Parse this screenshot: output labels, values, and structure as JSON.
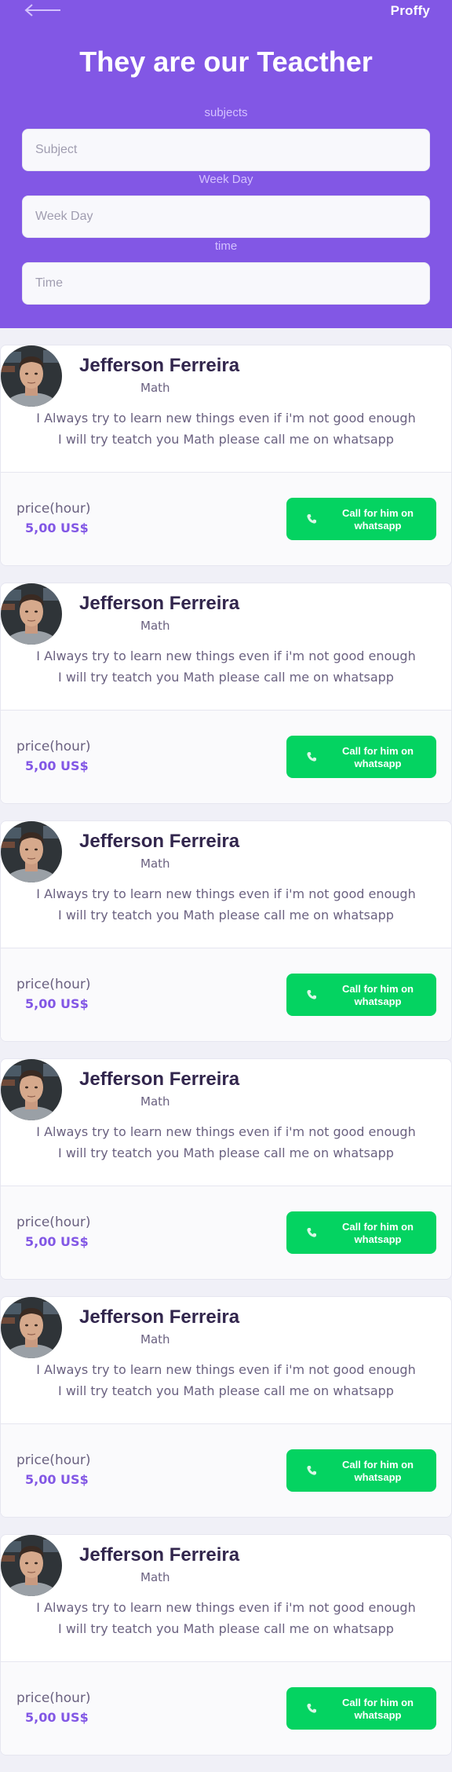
{
  "header": {
    "logo": "Proffy",
    "title": "They are our Teacther",
    "fields": [
      {
        "label": "subjects",
        "placeholder": "Subject"
      },
      {
        "label": "Week Day",
        "placeholder": "Week Day"
      },
      {
        "label": "time",
        "placeholder": "Time"
      }
    ]
  },
  "colors": {
    "primary": "#8257e5",
    "background": "#f0f0f7",
    "whatsapp": "#04d361"
  },
  "icons": {
    "back": "arrow-left-icon",
    "call": "whatsapp-icon",
    "avatar": "teacher-photo"
  },
  "teachers": [
    {
      "name": "Jefferson Ferreira",
      "subject": "Math",
      "bio_line1": "I Always try to learn new things even if i'm not good enough",
      "bio_line2": "I will try teatch you Math please call me on whatsapp",
      "price_label": "price(hour)",
      "price": "5,00 US$",
      "button_label": "Call for him on whatsapp"
    },
    {
      "name": "Jefferson Ferreira",
      "subject": "Math",
      "bio_line1": "I Always try to learn new things even if i'm not good enough",
      "bio_line2": "I will try teatch you Math please call me on whatsapp",
      "price_label": "price(hour)",
      "price": "5,00 US$",
      "button_label": "Call for him on whatsapp"
    },
    {
      "name": "Jefferson Ferreira",
      "subject": "Math",
      "bio_line1": "I Always try to learn new things even if i'm not good enough",
      "bio_line2": "I will try teatch you Math please call me on whatsapp",
      "price_label": "price(hour)",
      "price": "5,00 US$",
      "button_label": "Call for him on whatsapp"
    },
    {
      "name": "Jefferson Ferreira",
      "subject": "Math",
      "bio_line1": "I Always try to learn new things even if i'm not good enough",
      "bio_line2": "I will try teatch you Math please call me on whatsapp",
      "price_label": "price(hour)",
      "price": "5,00 US$",
      "button_label": "Call for him on whatsapp"
    },
    {
      "name": "Jefferson Ferreira",
      "subject": "Math",
      "bio_line1": "I Always try to learn new things even if i'm not good enough",
      "bio_line2": "I will try teatch you Math please call me on whatsapp",
      "price_label": "price(hour)",
      "price": "5,00 US$",
      "button_label": "Call for him on whatsapp"
    },
    {
      "name": "Jefferson Ferreira",
      "subject": "Math",
      "bio_line1": "I Always try to learn new things even if i'm not good enough",
      "bio_line2": "I will try teatch you Math please call me on whatsapp",
      "price_label": "price(hour)",
      "price": "5,00 US$",
      "button_label": "Call for him on whatsapp"
    }
  ]
}
